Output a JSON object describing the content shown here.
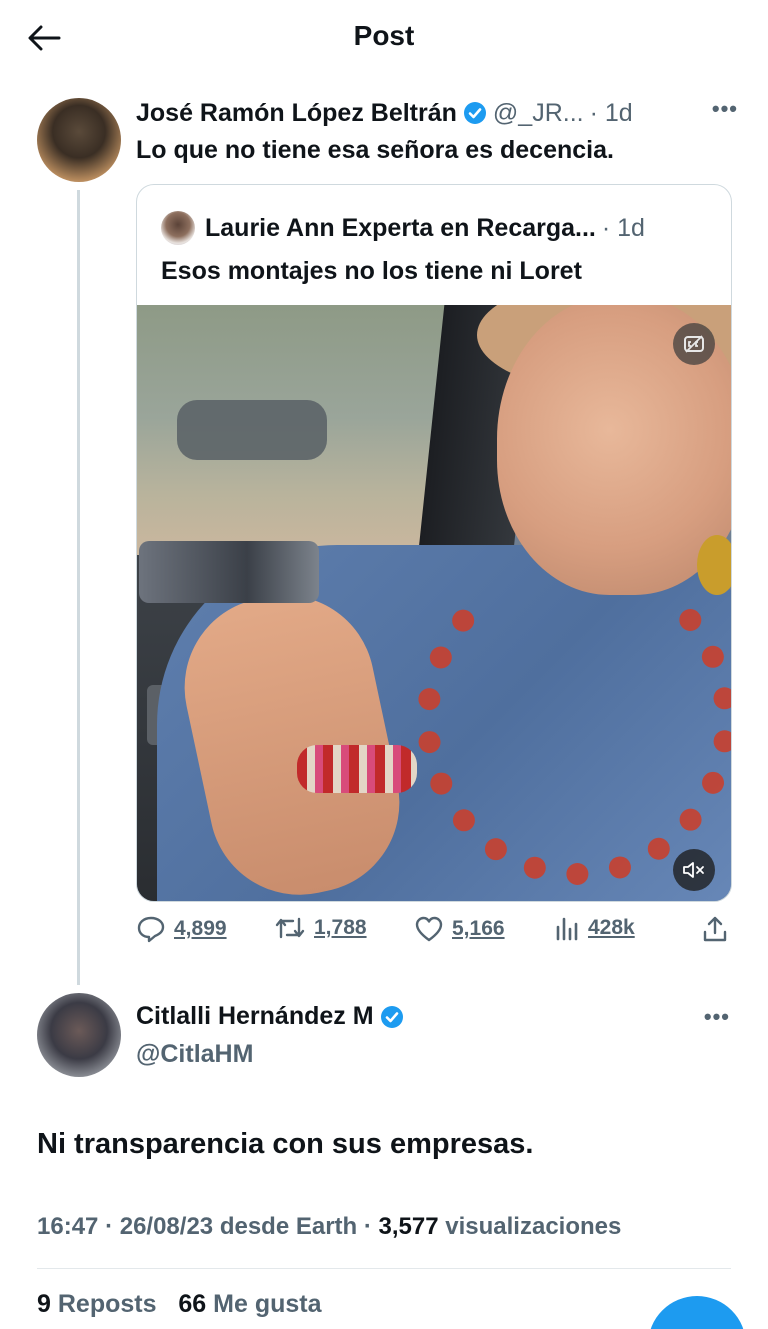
{
  "topbar": {
    "title": "Post"
  },
  "post": {
    "author_name": "José Ramón López Beltrán",
    "author_handle": "@_JR...",
    "time": "· 1d",
    "text": "Lo que no tiene esa señora es decencia.",
    "quote": {
      "author_name": "Laurie Ann Experta en Recarga...",
      "time": "· 1d",
      "text": "Esos montajes no los tiene ni Loret"
    },
    "actions": {
      "replies": "4,899",
      "reposts": "1,788",
      "likes": "5,166",
      "views": "428k"
    }
  },
  "reply": {
    "author_name": "Citlalli Hernández M",
    "author_handle": "@CitlaHM",
    "text": "Ni transparencia con sus empresas.",
    "meta": {
      "time": "16:47",
      "date_source": "· 26/08/23 desde Earth ·",
      "views_count": "3,577",
      "views_label": "visualizaciones"
    },
    "stats": {
      "reposts_count": "9",
      "reposts_label": "Reposts",
      "likes_count": "66",
      "likes_label": "Me gusta"
    }
  },
  "colors": {
    "accent": "#1d9bf0",
    "muted": "#536471",
    "text": "#0f1419",
    "border": "#cfd9de"
  },
  "icons": [
    "back-arrow-icon",
    "verified-badge-icon",
    "more-icon",
    "captions-icon",
    "mute-icon",
    "reply-icon",
    "repost-icon",
    "like-icon",
    "views-icon",
    "share-icon"
  ]
}
